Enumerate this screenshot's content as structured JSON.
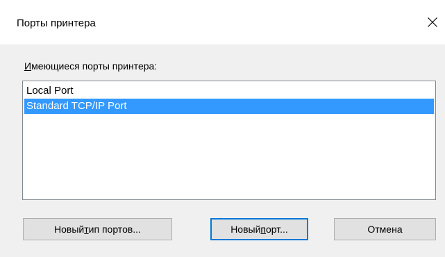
{
  "window": {
    "title": "Порты принтера",
    "close_icon": "close-x-icon"
  },
  "ports": {
    "label_mnemonic": "И",
    "label_rest": "меющиеся порты принтера:",
    "items": [
      {
        "label": "Local Port",
        "selected": false
      },
      {
        "label": "Standard TCP/IP Port",
        "selected": true
      }
    ],
    "selection_color": "#3399ff"
  },
  "buttons": {
    "new_type": {
      "before": "Новый ",
      "mnemonic": "т",
      "after": "ип портов..."
    },
    "new_port": {
      "before": "Новый ",
      "mnemonic": "п",
      "after": "орт..."
    },
    "cancel": {
      "label": "Отмена"
    }
  },
  "colors": {
    "default_button_border": "#0078d7"
  }
}
